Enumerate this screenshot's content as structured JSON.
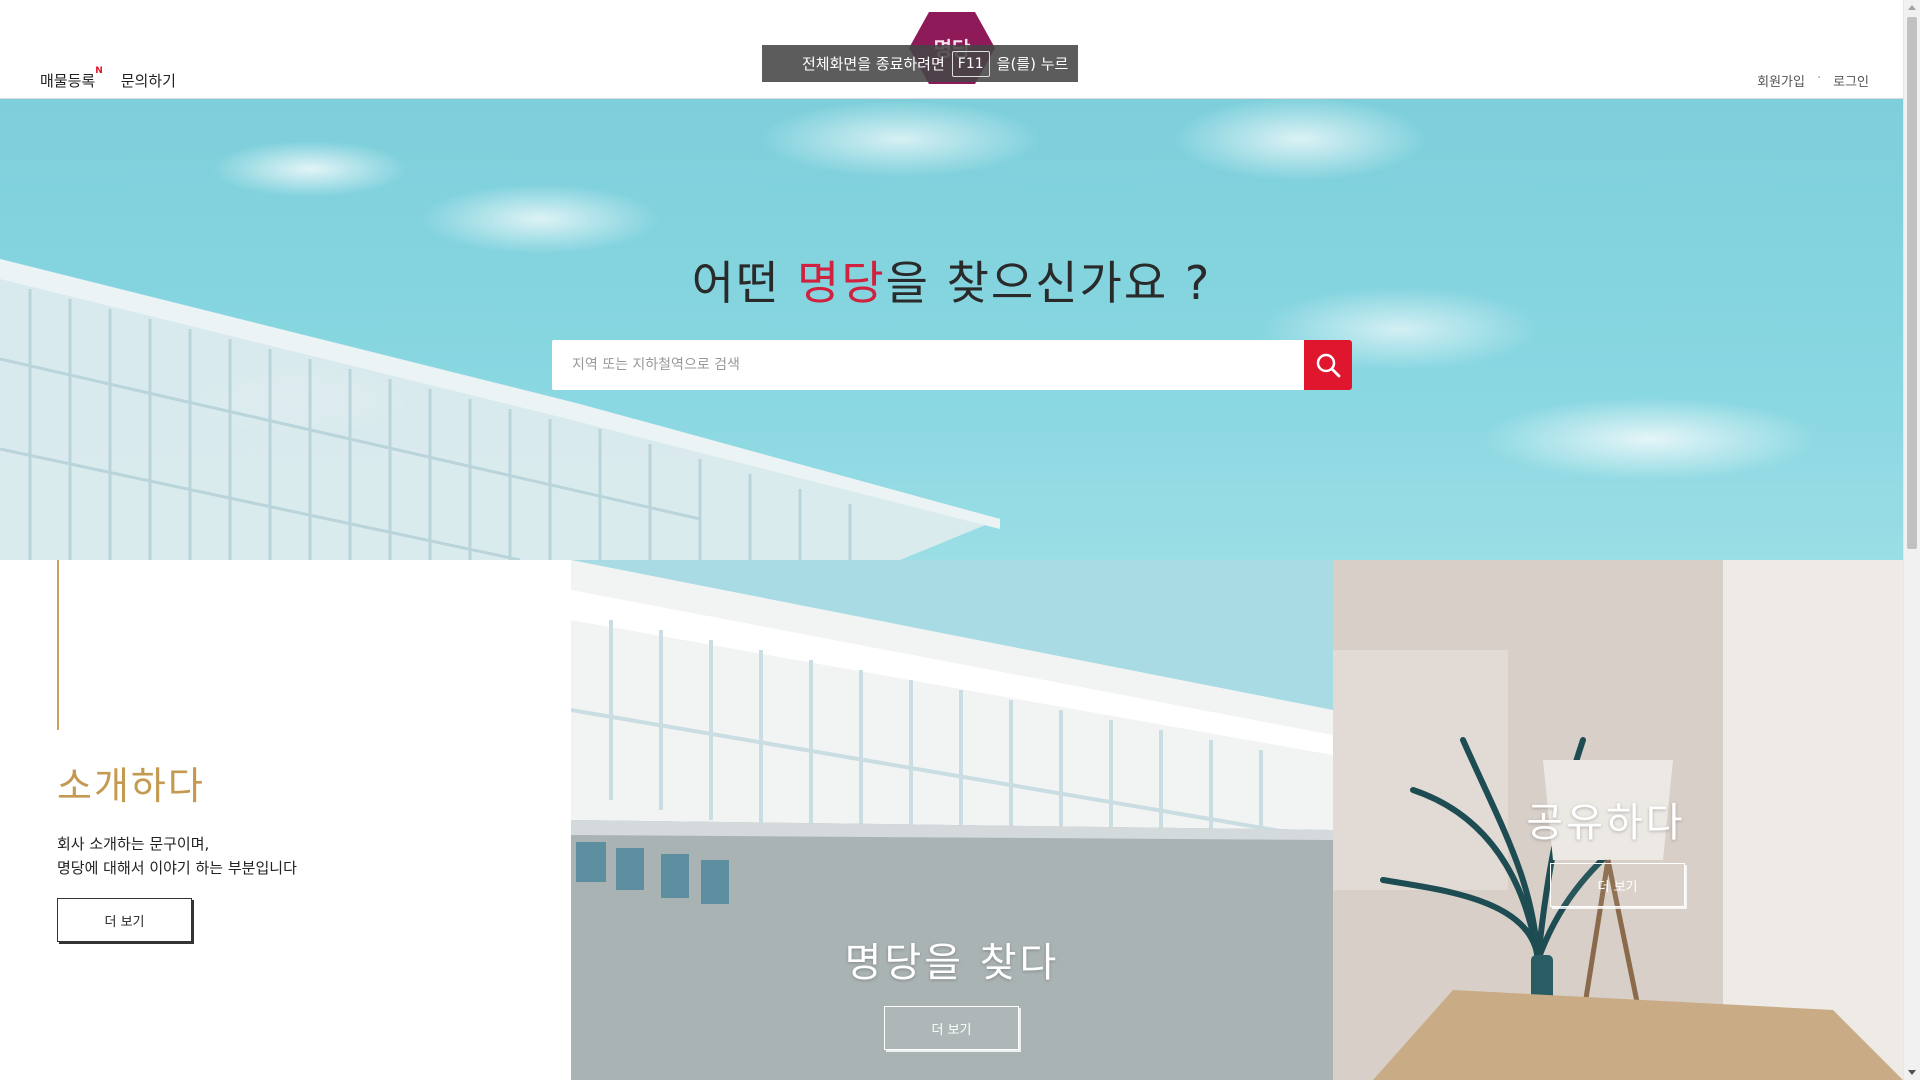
{
  "header": {
    "nav_left": [
      {
        "label": "매물등록",
        "badge": "N"
      },
      {
        "label": "문의하기"
      }
    ],
    "nav_right": {
      "signup": "회원가입",
      "separator": "·",
      "login": "로그인"
    },
    "logo": {
      "text": "명당"
    },
    "fullscreen_notice": {
      "before": "전체화면을 종료하려면",
      "key": "F11",
      "after": "을(를) 누르"
    }
  },
  "hero": {
    "title_before": "어떤 ",
    "title_accent": "명당",
    "title_after": "을 찾으신가요 ?",
    "search": {
      "placeholder": "지역 또는 지하철역으로 검색",
      "value": ""
    },
    "accent_color": "#e0152e"
  },
  "panels": {
    "intro": {
      "title": "소개하다",
      "desc_lines": [
        "회사 소개하는 문구이며,",
        "명당에 대해서 이야기 하는 부분입니다"
      ],
      "button": "더 보기"
    },
    "find": {
      "title": "명당을 찾다",
      "button": "더 보기"
    },
    "share": {
      "title": "공유하다",
      "button": "더 보기"
    }
  }
}
